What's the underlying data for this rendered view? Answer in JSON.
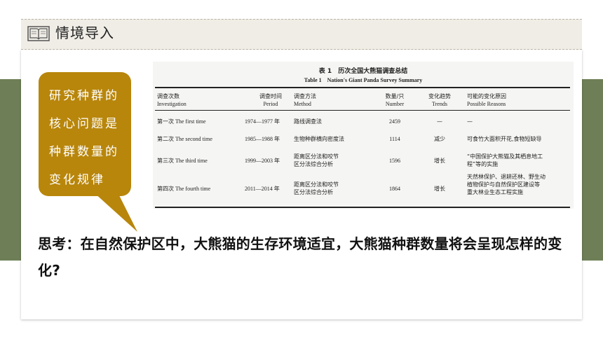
{
  "header": {
    "title": "情境导入",
    "icon": "book-icon"
  },
  "bubble": {
    "text": "研究种群的核心问题是种群数量的变化规律"
  },
  "table": {
    "caption_cn": "表 1　历次全国大熊猫调查总结",
    "caption_en": "Table 1　Nation's Giant Panda Survey Summary",
    "headers": [
      {
        "cn": "调查次数",
        "en": "Investigation"
      },
      {
        "cn": "调查时间",
        "en": "Period"
      },
      {
        "cn": "调查方法",
        "en": "Method"
      },
      {
        "cn": "数量/只",
        "en": "Number"
      },
      {
        "cn": "变化趋势",
        "en": "Trends"
      },
      {
        "cn": "可能的变化原因",
        "en": "Possible Reasons"
      }
    ],
    "rows": [
      {
        "inv": "第一次 The first time",
        "period": "1974—1977 年",
        "method": [
          "路线调查法"
        ],
        "number": "2459",
        "trend": "—",
        "reason": [
          "—"
        ]
      },
      {
        "inv": "第二次 The second time",
        "period": "1985—1988 年",
        "method": [
          "生物种群横向密度法"
        ],
        "number": "1114",
        "trend": "减少",
        "reason": [
          "可食竹大面积开花,食物短缺导"
        ]
      },
      {
        "inv": "第三次 The third time",
        "period": "1999—2003 年",
        "method": [
          "距离区分法和咬节",
          "区分法综合分析"
        ],
        "number": "1596",
        "trend": "增长",
        "reason": [
          "“中国保护大熊猫及其栖息地工",
          "程”等的实施"
        ]
      },
      {
        "inv": "第四次 The fourth time",
        "period": "2011—2014 年",
        "method": [
          "距离区分法和咬节",
          "区分法综合分析"
        ],
        "number": "1864",
        "trend": "增长",
        "reason": [
          "天然林保护、退耕还林、野生动",
          "植物保护与自然保护区建设等",
          "重大林业生态工程实施"
        ]
      }
    ]
  },
  "question": "思考：在自然保护区中，大熊猫的生存环境适宜，大熊猫种群数量将会呈现怎样的变化?",
  "colors": {
    "band": "#6e7f57",
    "bubble": "#b8860b",
    "header_bg": "#f0ede6"
  }
}
